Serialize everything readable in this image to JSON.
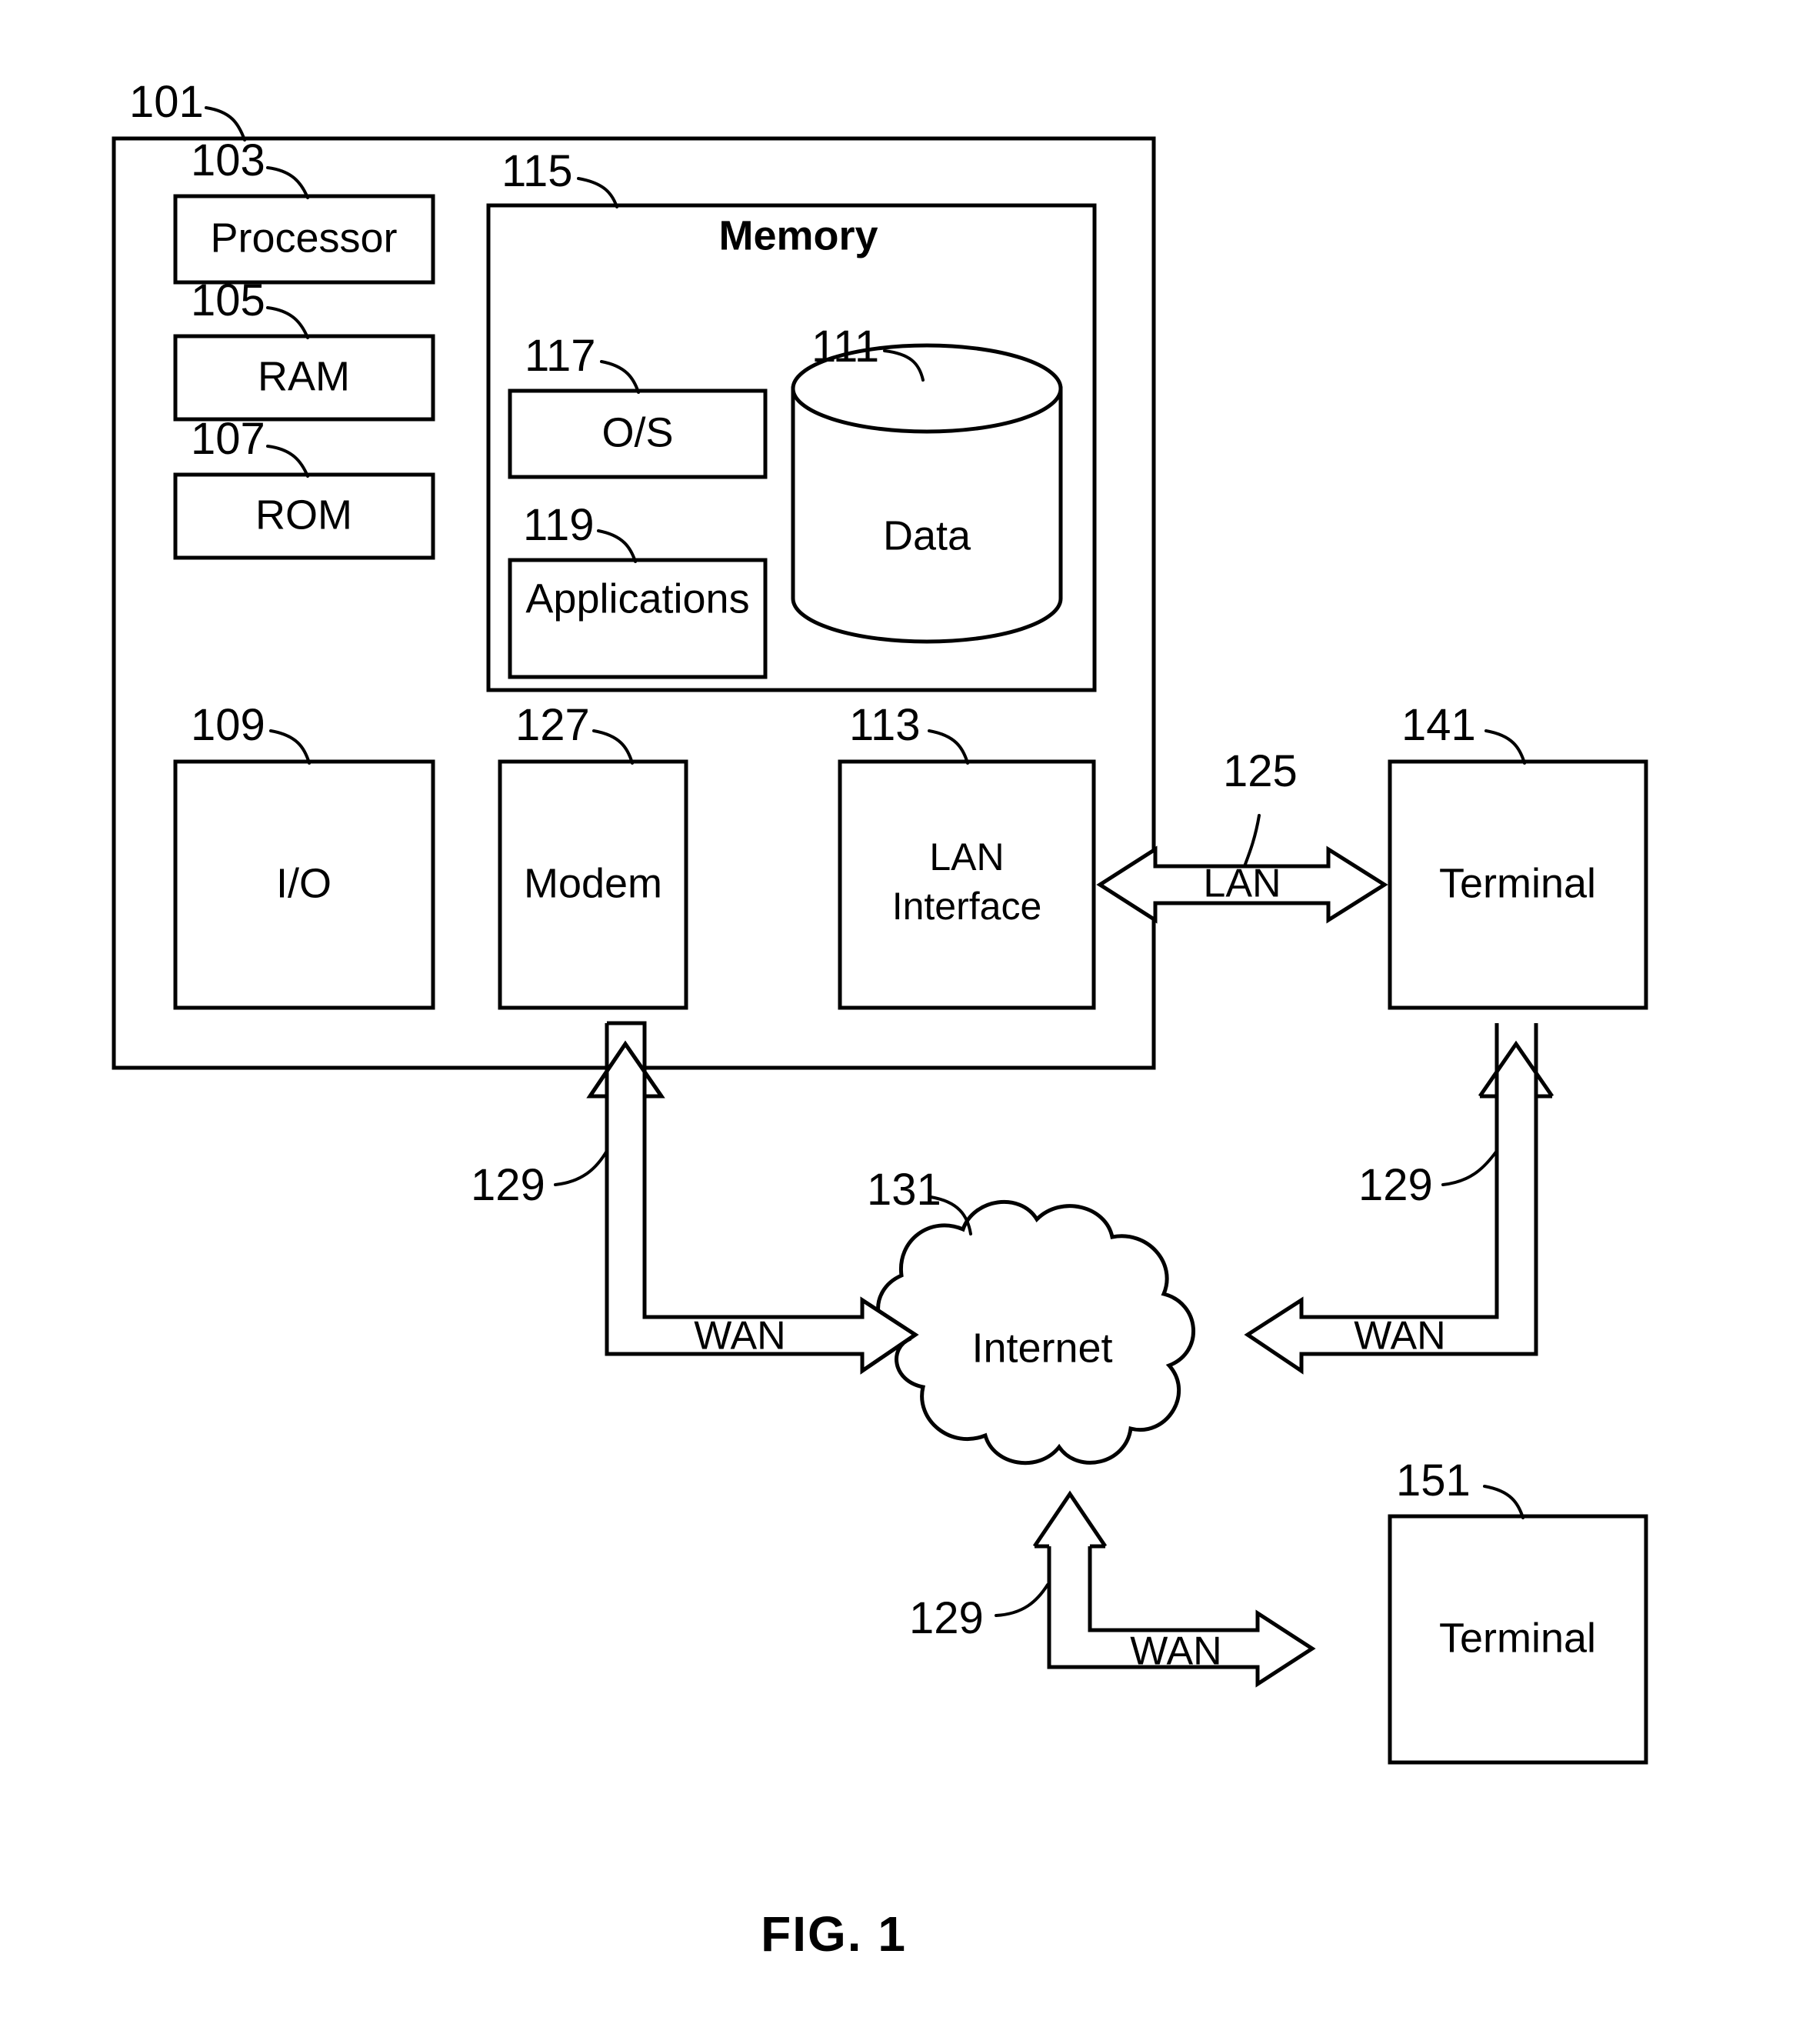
{
  "figure": {
    "caption": "FIG. 1",
    "type": "patent-block-diagram"
  },
  "outer_enclosure": {
    "ref": "101"
  },
  "blocks": [
    {
      "ref": "103",
      "label": "Processor",
      "name": "processor-block"
    },
    {
      "ref": "105",
      "label": "RAM",
      "name": "ram-block"
    },
    {
      "ref": "107",
      "label": "ROM",
      "name": "rom-block"
    },
    {
      "ref": "109",
      "label": "I/O",
      "name": "io-block"
    },
    {
      "ref": "127",
      "label": "Modem",
      "name": "modem-block"
    },
    {
      "ref": "113",
      "label_line1": "LAN",
      "label_line2": "Interface",
      "name": "lan-interface-block"
    }
  ],
  "memory": {
    "ref": "115",
    "title": "Memory",
    "os": {
      "ref": "117",
      "label": "O/S"
    },
    "applications": {
      "ref": "119",
      "label": "Applications"
    },
    "data_store": {
      "ref": "111",
      "label": "Data"
    }
  },
  "network": {
    "lan_link": {
      "ref": "125",
      "label": "LAN"
    },
    "internet": {
      "ref": "131",
      "label": "Internet"
    },
    "wan_links": [
      {
        "ref": "129",
        "label": "WAN",
        "name": "wan-link-modem"
      },
      {
        "ref": "129",
        "label": "WAN",
        "name": "wan-link-terminal-141"
      },
      {
        "ref": "129",
        "label": "WAN",
        "name": "wan-link-terminal-151"
      }
    ]
  },
  "terminals": [
    {
      "ref": "141",
      "label": "Terminal",
      "name": "terminal-141"
    },
    {
      "ref": "151",
      "label": "Terminal",
      "name": "terminal-151"
    }
  ],
  "colors": {
    "stroke": "#000000",
    "background": "#ffffff"
  }
}
